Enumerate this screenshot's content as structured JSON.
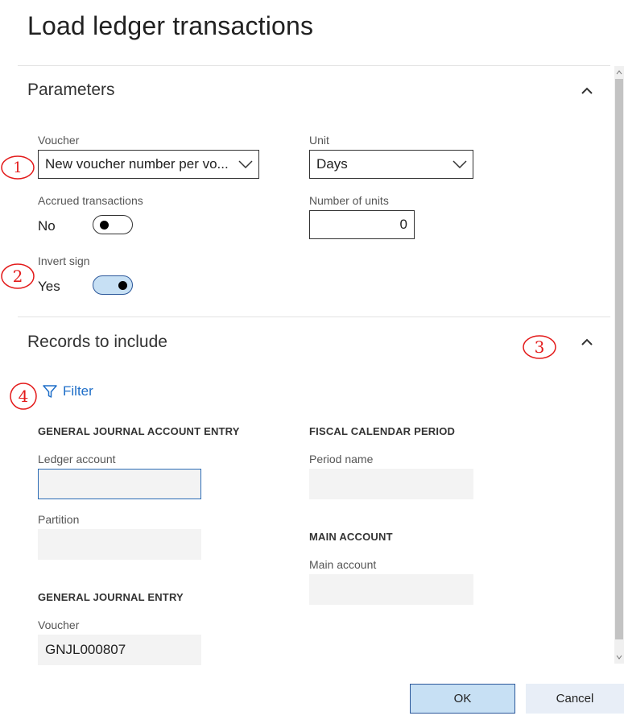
{
  "dialog": {
    "title": "Load ledger transactions"
  },
  "parameters": {
    "title": "Parameters",
    "voucher": {
      "label": "Voucher",
      "value": "New voucher number per vo..."
    },
    "unit": {
      "label": "Unit",
      "value": "Days"
    },
    "accrued_transactions": {
      "label": "Accrued transactions",
      "value_text": "No",
      "state": "off"
    },
    "number_of_units": {
      "label": "Number of units",
      "value": "0"
    },
    "invert_sign": {
      "label": "Invert sign",
      "value_text": "Yes",
      "state": "on"
    }
  },
  "records": {
    "title": "Records to include",
    "filter_label": "Filter",
    "general_journal_account_entry": {
      "heading": "GENERAL JOURNAL ACCOUNT ENTRY",
      "ledger_account": {
        "label": "Ledger account",
        "value": ""
      },
      "partition": {
        "label": "Partition",
        "value": ""
      }
    },
    "general_journal_entry": {
      "heading": "GENERAL JOURNAL ENTRY",
      "voucher": {
        "label": "Voucher",
        "value": "GNJL000807"
      }
    },
    "fiscal_calendar_period": {
      "heading": "FISCAL CALENDAR PERIOD",
      "period_name": {
        "label": "Period name",
        "value": ""
      }
    },
    "main_account": {
      "heading": "MAIN ACCOUNT",
      "main_account": {
        "label": "Main account",
        "value": ""
      }
    }
  },
  "buttons": {
    "ok": "OK",
    "cancel": "Cancel"
  },
  "annotations": [
    "1",
    "2",
    "3",
    "4"
  ],
  "colors": {
    "accent": "#2b579a",
    "link": "#1e6ec8",
    "toggle_on": "#c7e0f4",
    "annotation": "#e31a1a"
  },
  "icons": {
    "collapse": "chevron-up-icon",
    "dropdown": "chevron-down-icon",
    "filter": "filter-icon"
  }
}
